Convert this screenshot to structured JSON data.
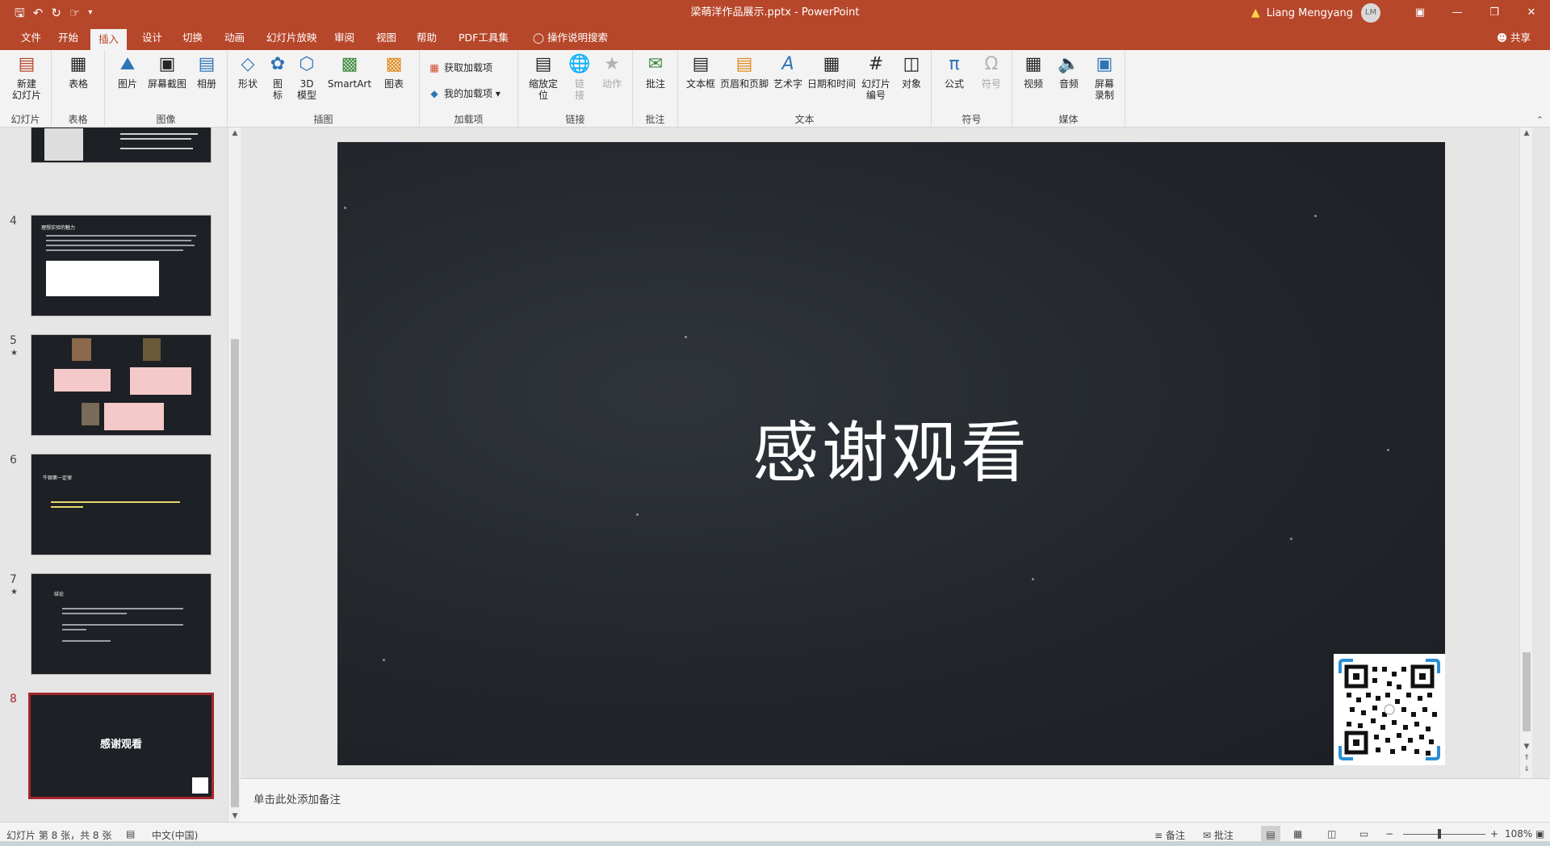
{
  "colors": {
    "accent": "#b7472a",
    "slide_bg": "#22262b",
    "selected_border": "#a4262c"
  },
  "titlebar": {
    "doc_title": "梁萌洋作品展示.pptx - PowerPoint",
    "user_name": "Liang Mengyang",
    "avatar_initials": "LM",
    "qat_icons": [
      "save-icon",
      "undo-icon",
      "redo-icon",
      "touch-mode-icon",
      "customize-icon"
    ]
  },
  "tabs": [
    "文件",
    "开始",
    "插入",
    "设计",
    "切换",
    "动画",
    "幻灯片放映",
    "审阅",
    "视图",
    "帮助",
    "PDF工具集",
    "操作说明搜索"
  ],
  "active_tab": "插入",
  "share_label": "共享",
  "ribbon": {
    "groups": {
      "slides": "幻灯片",
      "tables": "表格",
      "images": "图像",
      "illustrations": "插图",
      "addins": "加载项",
      "links": "链接",
      "comments": "批注",
      "text": "文本",
      "symbols": "符号",
      "media": "媒体"
    },
    "buttons": {
      "new_slide": "新建\n幻灯片",
      "table": "表格",
      "pictures": "图片",
      "screenshot": "屏幕截图",
      "album": "相册",
      "shapes": "形状",
      "icons": "图\n标",
      "model3d": "3D\n模型",
      "smartart": "SmartArt",
      "chart": "图表",
      "get_addins": "获取加载项",
      "my_addins": "我的加载项",
      "zoom": "缩放定\n位",
      "link": "链\n接",
      "action": "动作",
      "comment": "批注",
      "textbox": "文本框",
      "header_footer": "页眉和页脚",
      "wordart": "艺术字",
      "datetime": "日期和时间",
      "slide_number": "幻灯片\n编号",
      "object": "对象",
      "equation": "公式",
      "symbol": "符号",
      "video": "视频",
      "audio": "音频",
      "screen_recording": "屏幕\n录制"
    }
  },
  "slides": [
    {
      "num": "4",
      "star": "",
      "title": "理想实验的魅力"
    },
    {
      "num": "5",
      "star": "★",
      "title": ""
    },
    {
      "num": "6",
      "star": "",
      "title": "牛顿第一定律"
    },
    {
      "num": "7",
      "star": "★",
      "title": "结论"
    },
    {
      "num": "8",
      "star": "",
      "title": "感谢观看"
    }
  ],
  "current_slide": {
    "title": "感谢观看"
  },
  "notes_placeholder": "单击此处添加备注",
  "statusbar": {
    "slide_info": "幻灯片 第 8 张，共 8 张",
    "language": "中文(中国)",
    "notes": "备注",
    "comments": "批注",
    "zoom": "108%",
    "zoom_level_percent": 108
  }
}
